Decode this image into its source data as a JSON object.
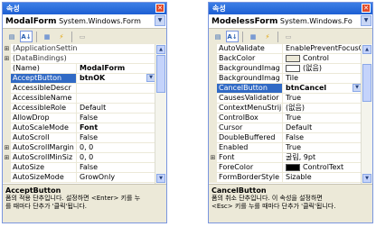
{
  "left": {
    "title": "속성",
    "object_name": "ModalForm",
    "object_type": "System.Windows.Form",
    "rows": [
      {
        "kind": "cat",
        "expander": "⊞",
        "name": "(ApplicationSettin"
      },
      {
        "kind": "cat",
        "expander": "⊞",
        "name": "(DataBindings)"
      },
      {
        "kind": "prop",
        "name": "(Name)",
        "value": "ModalForm",
        "bold": true
      },
      {
        "kind": "prop",
        "name": "AcceptButton",
        "value": "btnOK",
        "bold": true,
        "selected": true,
        "dropdown": true
      },
      {
        "kind": "prop",
        "name": "AccessibleDescr",
        "value": ""
      },
      {
        "kind": "prop",
        "name": "AccessibleName",
        "value": ""
      },
      {
        "kind": "prop",
        "name": "AccessibleRole",
        "value": "Default"
      },
      {
        "kind": "prop",
        "name": "AllowDrop",
        "value": "False"
      },
      {
        "kind": "prop",
        "name": "AutoScaleMode",
        "value": "Font",
        "bold": true
      },
      {
        "kind": "prop",
        "name": "AutoScroll",
        "value": "False"
      },
      {
        "kind": "prop",
        "name": "AutoScrollMargin",
        "value": "0, 0",
        "expander": "⊞"
      },
      {
        "kind": "prop",
        "name": "AutoScrollMinSiz",
        "value": "0, 0",
        "expander": "⊞"
      },
      {
        "kind": "prop",
        "name": "AutoSize",
        "value": "False"
      },
      {
        "kind": "prop",
        "name": "AutoSizeMode",
        "value": "GrowOnly"
      }
    ],
    "desc_title": "AcceptButton",
    "desc_line1": "폼의 적용 단추입니다. 설정하면 <Enter> 키를 누",
    "desc_line2": "를 때마다 단추가 '클릭'됩니다."
  },
  "right": {
    "title": "속성",
    "object_name": "ModelessForm",
    "object_type": "System.Windows.Fo",
    "rows": [
      {
        "kind": "prop",
        "name": "AutoValidate",
        "value": "EnablePreventFocusCha"
      },
      {
        "kind": "prop",
        "name": "BackColor",
        "value": "Control",
        "swatch": "#ece9d8"
      },
      {
        "kind": "prop",
        "name": "BackgroundImag",
        "value": "(없음)",
        "swatch": "#ffffff"
      },
      {
        "kind": "prop",
        "name": "BackgroundImag",
        "value": "Tile"
      },
      {
        "kind": "prop",
        "name": "CancelButton",
        "value": "btnCancel",
        "bold": true,
        "selected": true,
        "dropdown": true
      },
      {
        "kind": "prop",
        "name": "CausesValidatior",
        "value": "True"
      },
      {
        "kind": "prop",
        "name": "ContextMenuStrij",
        "value": "(없음)"
      },
      {
        "kind": "prop",
        "name": "ControlBox",
        "value": "True"
      },
      {
        "kind": "prop",
        "name": "Cursor",
        "value": "Default"
      },
      {
        "kind": "prop",
        "name": "DoubleBuffered",
        "value": "False"
      },
      {
        "kind": "prop",
        "name": "Enabled",
        "value": "True"
      },
      {
        "kind": "prop",
        "name": "Font",
        "value": "굴림, 9pt",
        "expander": "⊞"
      },
      {
        "kind": "prop",
        "name": "ForeColor",
        "value": "ControlText",
        "swatch": "#000000"
      },
      {
        "kind": "prop",
        "name": "FormBorderStyle",
        "value": "Sizable"
      }
    ],
    "desc_title": "CancelButton",
    "desc_line1": "폼의 취소 단추입니다. 이 속성을 설정하면",
    "desc_line2": "<Esc> 키를 누를 때마다 단추가 '클릭'됩니다."
  },
  "toolbar_icons": [
    "categorized-icon",
    "alphabetical-icon",
    "properties-icon",
    "events-icon",
    "property-pages-icon"
  ]
}
